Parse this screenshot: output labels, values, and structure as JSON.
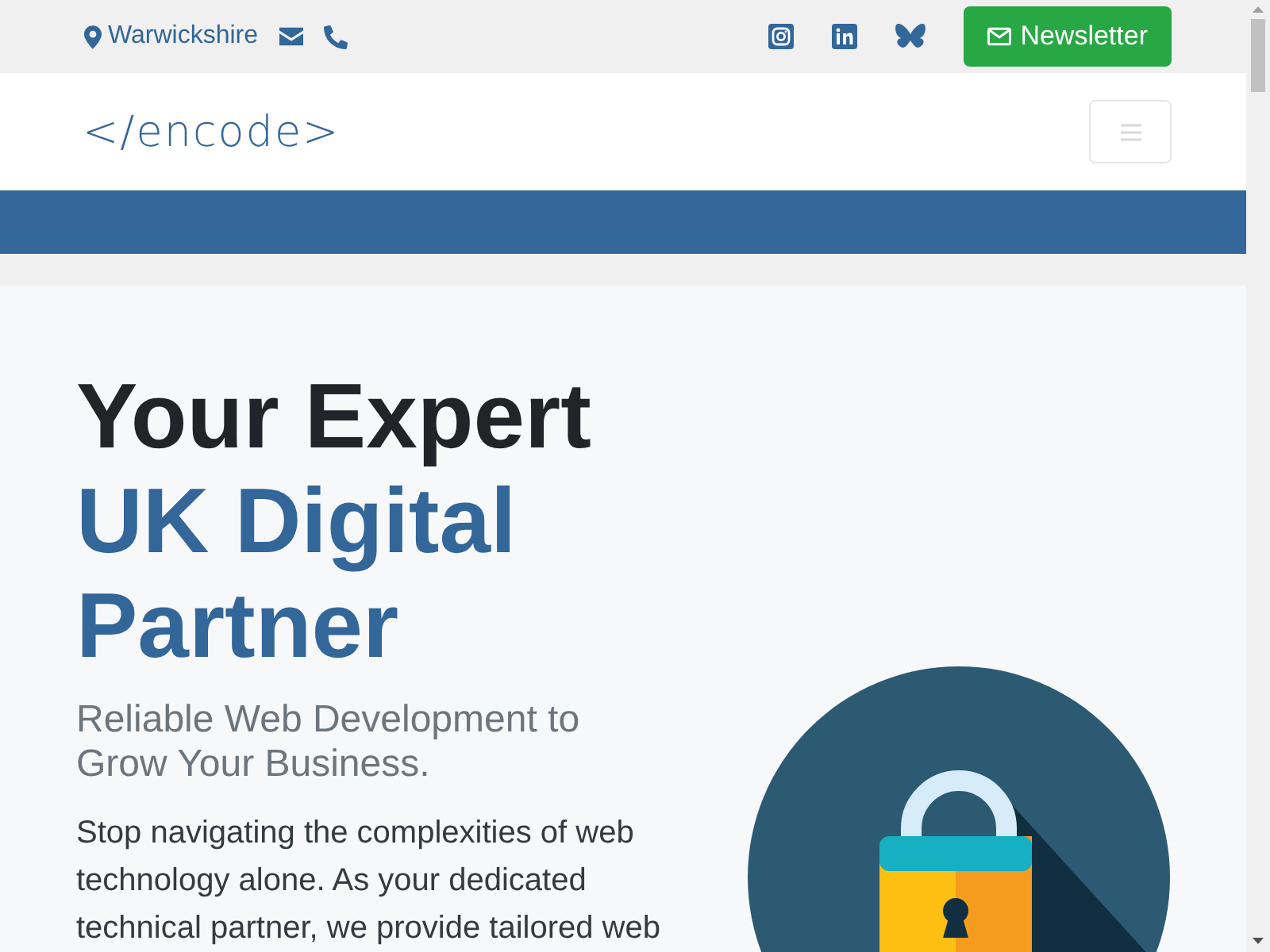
{
  "topbar": {
    "location": "Warwickshire",
    "newsletter_button": "Newsletter"
  },
  "navbar": {
    "logo": "</encode>"
  },
  "hero": {
    "title_line": "Your Expert",
    "title_highlight": "UK Digital Partner",
    "subtitle": "Reliable Web Development to Grow Your Business.",
    "body": "Stop navigating the complexities of web technology alone. As your dedicated technical partner, we provide tailored web"
  }
}
